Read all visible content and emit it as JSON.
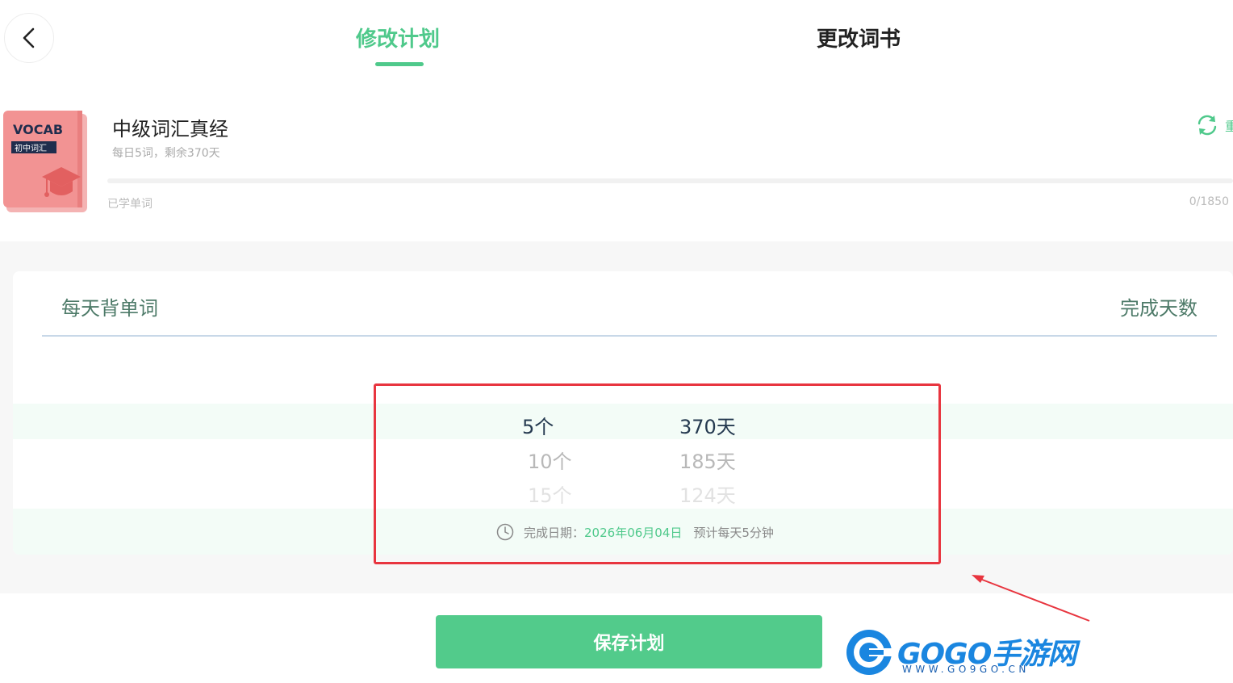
{
  "header": {
    "tabs": [
      {
        "label": "修改计划",
        "active": true
      },
      {
        "label": "更改词书",
        "active": false
      }
    ]
  },
  "book": {
    "cover_brand": "VOCAB",
    "cover_tag": "初中词汇",
    "title": "中级词汇真经",
    "subtitle": "每日5词，剩余370天",
    "learned_label": "已学单词",
    "learned_count": "0/1850",
    "progress": 0,
    "reset_label": "重"
  },
  "plan": {
    "col_left": "每天背单词",
    "col_right": "完成天数",
    "words_options": [
      "5个",
      "10个",
      "15个"
    ],
    "days_options": [
      "370天",
      "185天",
      "124天"
    ],
    "finish_label": "完成日期：",
    "finish_date": "2026年06月04日",
    "estimate": "预计每天5分钟"
  },
  "save_label": "保存计划",
  "watermark": {
    "text": "GOGO手游网",
    "url": "WWW.GO9GO.CN"
  },
  "colors": {
    "accent": "#4fc98b",
    "highlight_box": "#e8353f"
  }
}
